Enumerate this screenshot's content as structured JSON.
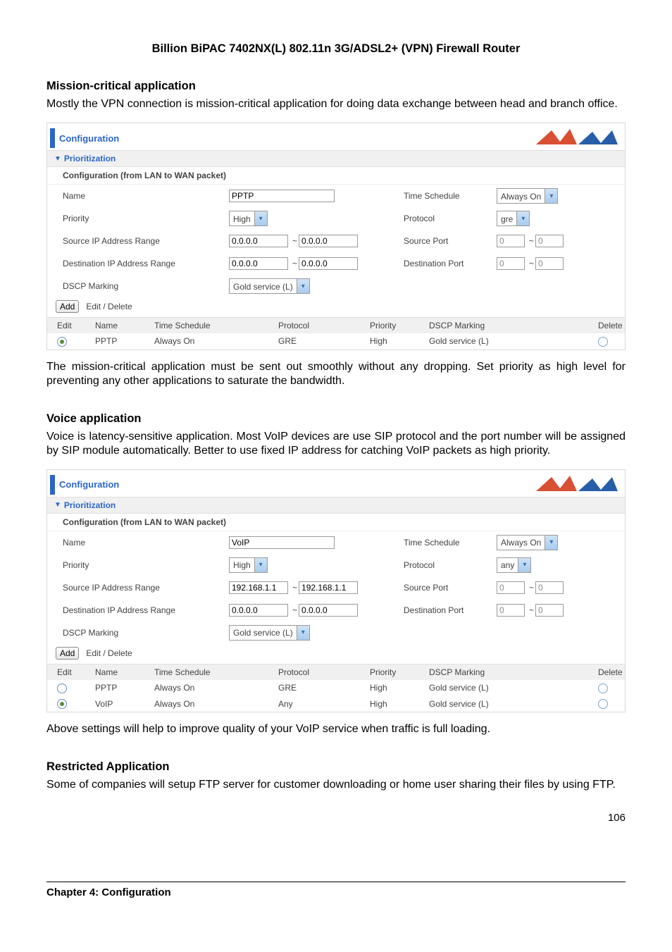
{
  "header_title": "Billion BiPAC 7402NX(L) 802.11n 3G/ADSL2+ (VPN) Firewall Router",
  "sections": {
    "mission": {
      "title": "Mission-critical application",
      "body": "Mostly the VPN connection is mission-critical application for doing data exchange between head and branch office.",
      "after": "The mission-critical application must be sent out smoothly without any dropping. Set priority as high level for preventing any other applications to saturate the bandwidth."
    },
    "voice": {
      "title": "Voice application",
      "body": "Voice is latency-sensitive application. Most VoIP devices are use SIP protocol and the port number will be assigned by SIP module automatically. Better to use fixed IP address for catching VoIP packets as high priority.",
      "after": "Above settings will help to improve quality of your VoIP service when traffic is full loading."
    },
    "restricted": {
      "title": "Restricted Application",
      "body": "Some of companies will setup FTP server for customer downloading or home user sharing their files by using FTP."
    }
  },
  "panel": {
    "title": "Configuration",
    "sub": "Prioritization",
    "sub2": "Configuration (from LAN to WAN packet)",
    "labels": {
      "name": "Name",
      "time_schedule": "Time Schedule",
      "priority": "Priority",
      "protocol": "Protocol",
      "src_ip": "Source IP Address Range",
      "src_port": "Source Port",
      "dst_ip": "Destination IP Address Range",
      "dst_port": "Destination Port",
      "dscp": "DSCP Marking",
      "add": "Add",
      "editdelete": "Edit / Delete"
    },
    "list_head": {
      "edit": "Edit",
      "name": "Name",
      "ts": "Time Schedule",
      "proto": "Protocol",
      "prio": "Priority",
      "dscp": "DSCP Marking",
      "del": "Delete"
    }
  },
  "panel1": {
    "name": "PPTP",
    "time_schedule": "Always On",
    "priority": "High",
    "protocol": "gre",
    "src_ip_a": "0.0.0.0",
    "src_ip_b": "0.0.0.0",
    "src_port_a": "0",
    "src_port_b": "0",
    "dst_ip_a": "0.0.0.0",
    "dst_ip_b": "0.0.0.0",
    "dst_port_a": "0",
    "dst_port_b": "0",
    "dscp": "Gold service (L)",
    "rows": [
      {
        "selected": true,
        "name": "PPTP",
        "ts": "Always On",
        "proto": "GRE",
        "prio": "High",
        "dscp": "Gold service (L)"
      }
    ]
  },
  "panel2": {
    "name": "VoIP",
    "time_schedule": "Always On",
    "priority": "High",
    "protocol": "any",
    "src_ip_a": "192.168.1.1",
    "src_ip_b": "192.168.1.1",
    "src_port_a": "0",
    "src_port_b": "0",
    "dst_ip_a": "0.0.0.0",
    "dst_ip_b": "0.0.0.0",
    "dst_port_a": "0",
    "dst_port_b": "0",
    "dscp": "Gold service (L)",
    "rows": [
      {
        "selected": false,
        "name": "PPTP",
        "ts": "Always On",
        "proto": "GRE",
        "prio": "High",
        "dscp": "Gold service (L)"
      },
      {
        "selected": true,
        "name": "VoIP",
        "ts": "Always On",
        "proto": "Any",
        "prio": "High",
        "dscp": "Gold service (L)"
      }
    ]
  },
  "footer": {
    "chapter": "Chapter 4: Configuration",
    "page": "106"
  },
  "tilde": "~"
}
